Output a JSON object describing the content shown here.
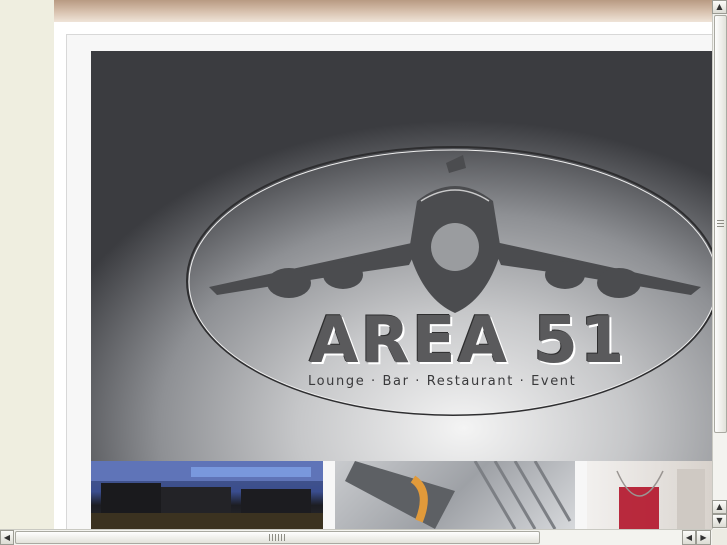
{
  "hero": {
    "brand_name": "AREA 51",
    "tagline": "Lounge · Bar · Restaurant · Event",
    "logo_icon": "airplane-icon"
  },
  "thumbnails": [
    {
      "name": "lounge-photo"
    },
    {
      "name": "jet-engine-photo"
    },
    {
      "name": "wine-glass-photo"
    }
  ],
  "scrollbars": {
    "up_arrow": "▲",
    "down_arrow": "▼",
    "left_arrow": "◀",
    "right_arrow": "▶",
    "vertical_position": 0,
    "horizontal_position": 0
  },
  "colors": {
    "top_bar": "#c9ae96",
    "left_panel": "#efeee0",
    "logo_gray": "#5a5a5c"
  }
}
